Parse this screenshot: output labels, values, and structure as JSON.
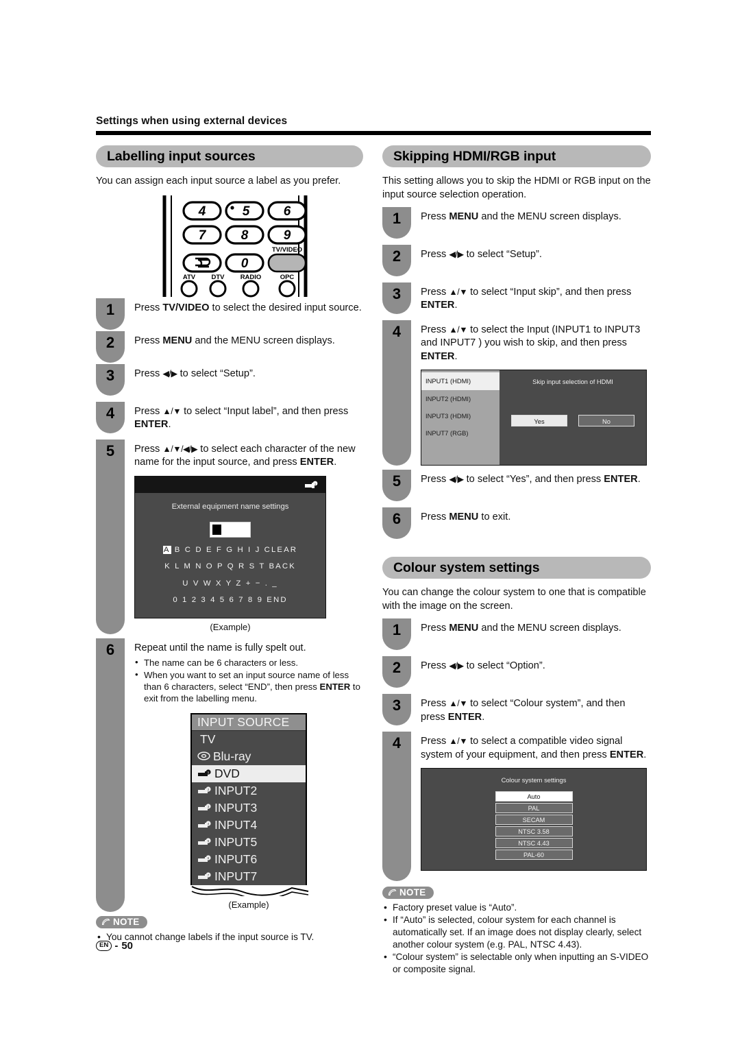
{
  "running_head": "Settings when using external devices",
  "footer": {
    "lang": "EN",
    "dash": "-",
    "page": "50"
  },
  "left": {
    "section_title": "Labelling input sources",
    "intro": "You can assign each input source a label as you prefer.",
    "remote": {
      "buttons": [
        "4",
        "5",
        "6",
        "7",
        "8",
        "9",
        "0"
      ],
      "tv_video_label": "TV/VIDEO",
      "bottom_labels": [
        "ATV",
        "DTV",
        "RADIO",
        "OPC"
      ]
    },
    "steps": [
      {
        "n": "1",
        "html": "Press <b>TV/VIDEO</b> to select the desired input source."
      },
      {
        "n": "2",
        "html": "Press <b>MENU</b> and the MENU screen displays."
      },
      {
        "n": "3",
        "html": "Press <span class='arrow'>◀/▶</span> to select “Setup”."
      },
      {
        "n": "4",
        "html": "Press <span class='arrow'>▲/▼</span> to select “Input label”, and then press <b>ENTER</b>."
      },
      {
        "n": "5",
        "html": "Press <span class='arrow'>▲/▼/◀/▶</span> to select each character of the new name for the input source, and press <b>ENTER</b>."
      },
      {
        "n": "6",
        "html": "Repeat until the name is fully spelt out."
      }
    ],
    "char_screen": {
      "title": "External equipment name settings",
      "rows": [
        "A B C D E F G H I J  CLEAR",
        "K L M N O P Q R S T  BACK",
        "U V W X Y Z + − . _",
        "0 1 2 3 4 5 6 7 8 9   END"
      ],
      "selected_char": "A",
      "caption": "(Example)"
    },
    "step6_bullets": [
      "The name can be 6 characters or less.",
      "When you want to set an input source name of less than 6 characters, select “END”, then press ENTER to exit from the labelling menu."
    ],
    "input_source": {
      "header": "INPUT SOURCE",
      "items": [
        {
          "label": "TV",
          "icon": "none",
          "selected": false
        },
        {
          "label": "Blu-ray",
          "icon": "disc-icon",
          "selected": false
        },
        {
          "label": "DVD",
          "icon": "input-connector-1-icon",
          "selected": true
        },
        {
          "label": "INPUT2",
          "icon": "input-connector-2-icon",
          "selected": false
        },
        {
          "label": "INPUT3",
          "icon": "input-connector-3-icon",
          "selected": false
        },
        {
          "label": "INPUT4",
          "icon": "input-connector-4-icon",
          "selected": false
        },
        {
          "label": "INPUT5",
          "icon": "input-connector-5-icon",
          "selected": false
        },
        {
          "label": "INPUT6",
          "icon": "input-connector-6-icon",
          "selected": false
        },
        {
          "label": "INPUT7",
          "icon": "input-connector-7-icon",
          "selected": false
        }
      ],
      "caption": "(Example)"
    },
    "note": {
      "label": "NOTE",
      "items": [
        "You cannot change labels if the input source is TV."
      ]
    }
  },
  "right": {
    "skip": {
      "section_title": "Skipping HDMI/RGB input",
      "intro": "This setting allows you to skip the HDMI or RGB input on the input source selection operation.",
      "steps": [
        {
          "n": "1",
          "html": "Press <b>MENU</b> and the MENU screen displays."
        },
        {
          "n": "2",
          "html": "Press <span class='arrow'>◀/▶</span> to select “Setup”."
        },
        {
          "n": "3",
          "html": "Press <span class='arrow'>▲/▼</span> to select “Input skip”, and then press <b>ENTER</b>."
        },
        {
          "n": "4",
          "html": "Press <span class='arrow'>▲/▼</span> to select the Input (INPUT1 to INPUT3 and INPUT7 ) you wish to skip, and then press <b>ENTER</b>."
        },
        {
          "n": "5",
          "html": "Press <span class='arrow'>◀/▶</span> to select “Yes”, and then press <b>ENTER</b>."
        },
        {
          "n": "6",
          "html": "Press <b>MENU</b> to exit."
        }
      ],
      "panel": {
        "inputs": [
          {
            "label": "INPUT1 (HDMI)",
            "selected": true
          },
          {
            "label": "INPUT2 (HDMI)",
            "selected": false
          },
          {
            "label": "INPUT3 (HDMI)",
            "selected": false
          },
          {
            "label": "INPUT7 (RGB)",
            "selected": false
          }
        ],
        "title": "Skip input selection of HDMI",
        "yes_label": "Yes",
        "no_label": "No"
      }
    },
    "colour": {
      "section_title": "Colour system settings",
      "intro": "You can change the colour system to one that is compatible with the image on the screen.",
      "steps": [
        {
          "n": "1",
          "html": "Press <b>MENU</b> and the MENU screen displays."
        },
        {
          "n": "2",
          "html": "Press <span class='arrow'>◀/▶</span> to select “Option”."
        },
        {
          "n": "3",
          "html": "Press <span class='arrow'>▲/▼</span> to select “Colour system”, and then press <b>ENTER</b>."
        },
        {
          "n": "4",
          "html": "Press <span class='arrow'>▲/▼</span> to select a compatible video signal system of your equipment, and then press <b>ENTER</b>."
        }
      ],
      "panel": {
        "title": "Colour system settings",
        "options": [
          {
            "label": "Auto",
            "selected": true
          },
          {
            "label": "PAL",
            "selected": false
          },
          {
            "label": "SECAM",
            "selected": false
          },
          {
            "label": "NTSC 3.58",
            "selected": false
          },
          {
            "label": "NTSC 4.43",
            "selected": false
          },
          {
            "label": "PAL-60",
            "selected": false
          }
        ]
      },
      "note": {
        "label": "NOTE",
        "items": [
          "Factory preset value is “Auto”.",
          "If “Auto” is selected, colour system for each channel is automatically set. If an image does not display clearly, select another colour system (e.g. PAL, NTSC 4.43).",
          "“Colour system” is selectable only when inputting an S-VIDEO or composite signal."
        ]
      }
    }
  },
  "colors": {
    "pill": "#b8b8b8",
    "badge": "#8d8d8d",
    "osd": "#4a4a4a",
    "rule": "#000000"
  }
}
